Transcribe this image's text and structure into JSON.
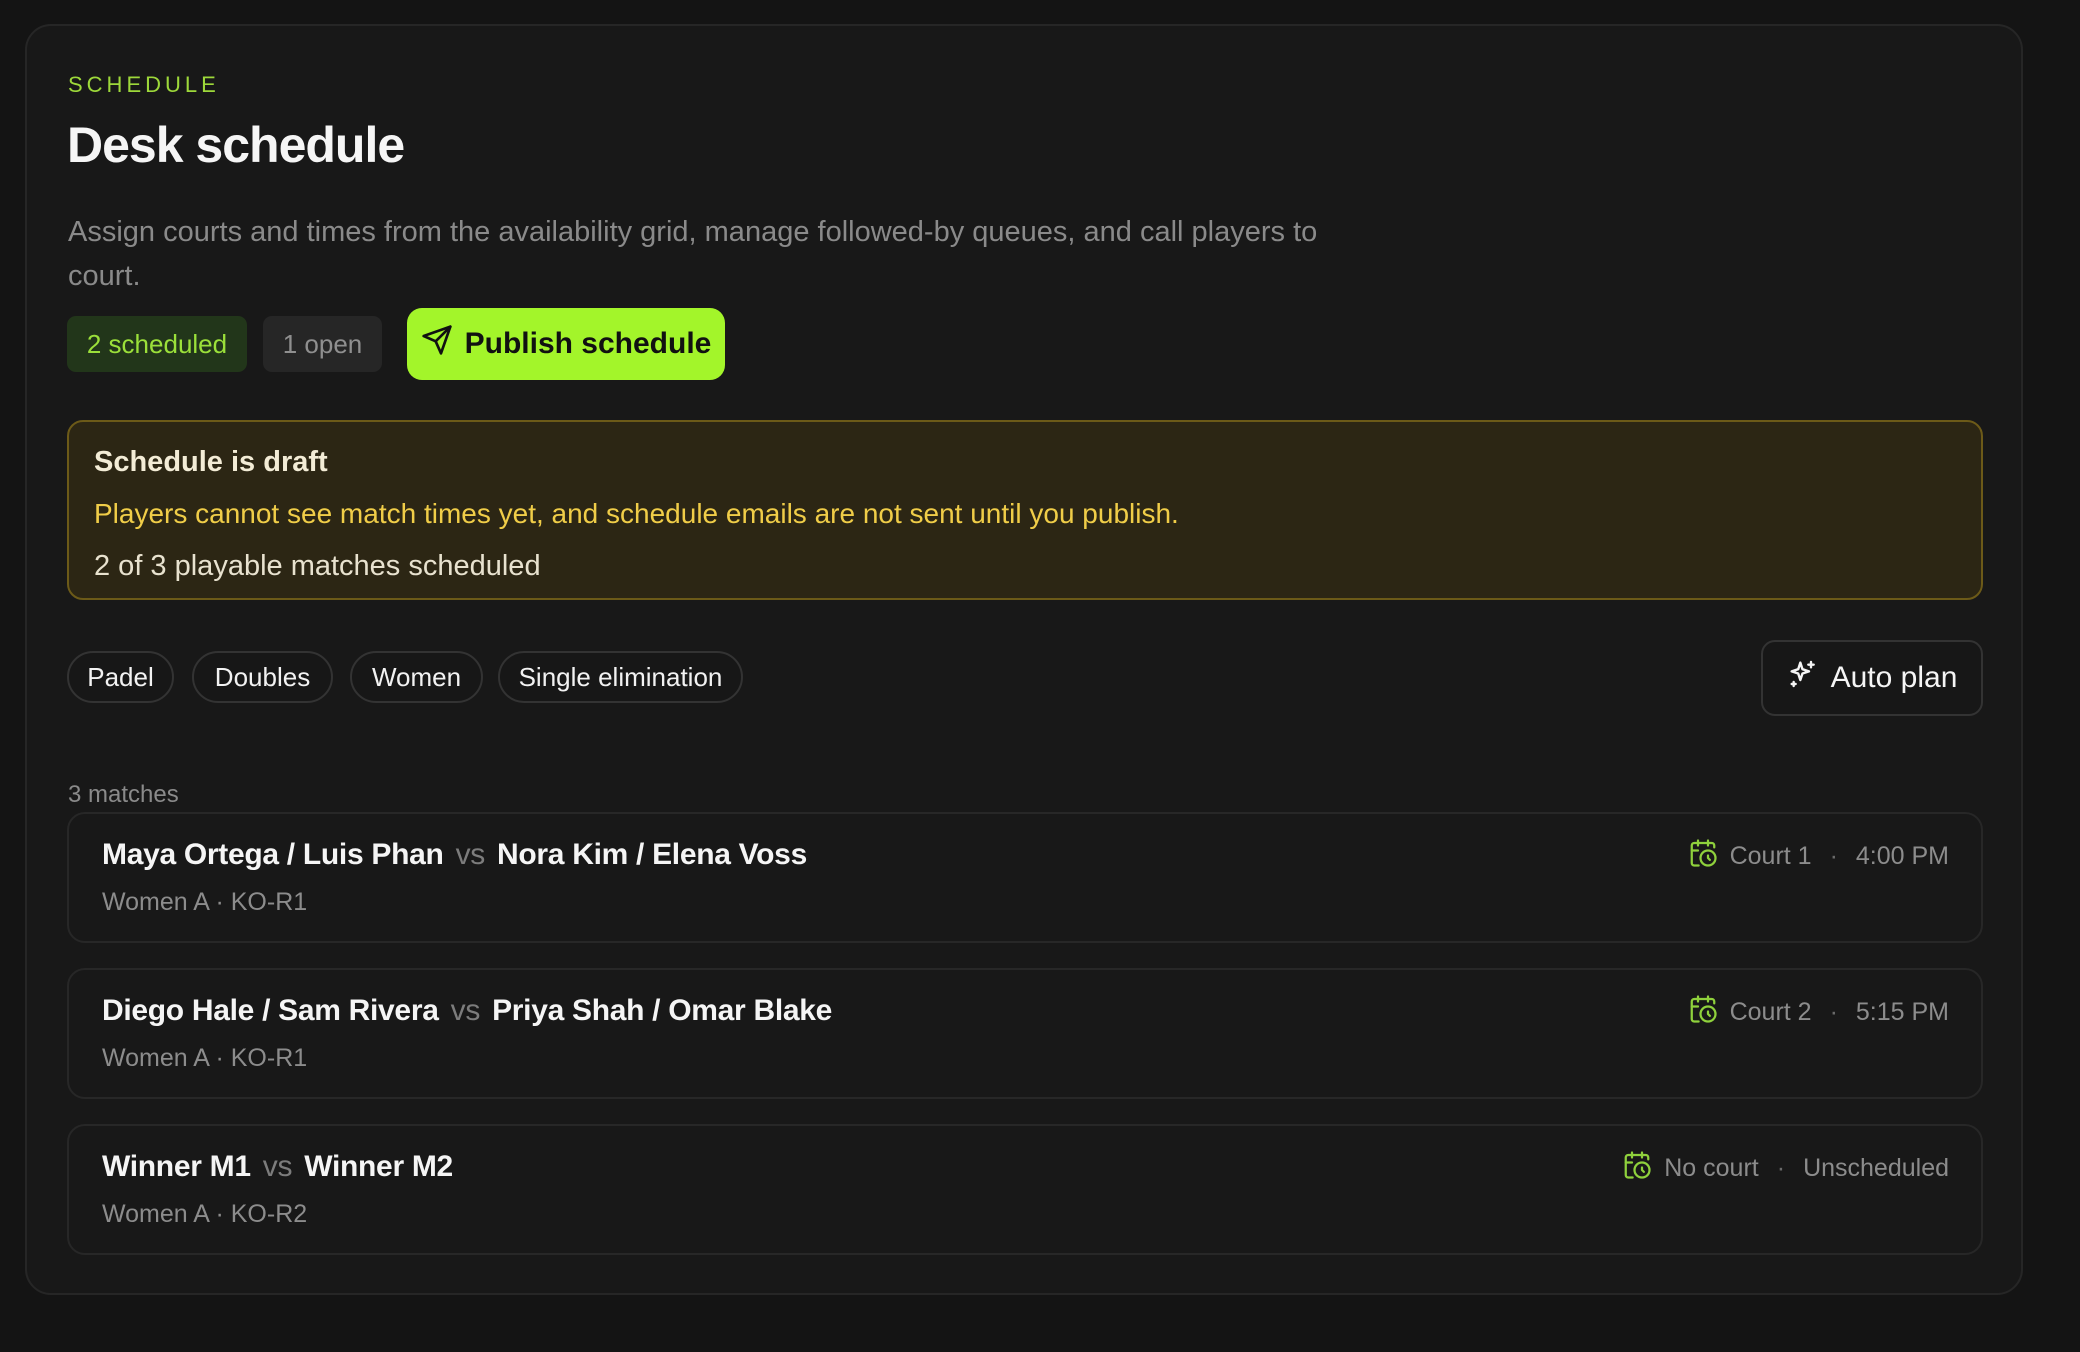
{
  "header": {
    "eyebrow": "SCHEDULE",
    "title": "Desk schedule",
    "subtitle": "Assign courts and times from the availability grid, manage followed-by queues, and call players to court."
  },
  "status": {
    "scheduled": "2 scheduled",
    "open": "1 open",
    "publish_label": "Publish schedule"
  },
  "draft": {
    "title": "Schedule is draft",
    "description": "Players cannot see match times yet, and schedule emails are not sent until you publish.",
    "progress": "2 of 3 playable matches scheduled"
  },
  "filters": {
    "tags": [
      "Padel",
      "Doubles",
      "Women",
      "Single elimination"
    ],
    "auto_plan_label": "Auto plan"
  },
  "matches": {
    "count_label": "3 matches",
    "vs_label": "vs",
    "items": [
      {
        "team_a": "Maya Ortega / Luis Phan",
        "team_b": "Nora Kim / Elena Voss",
        "meta": "Women A · KO-R1",
        "court": "Court 1",
        "time": "4:00 PM"
      },
      {
        "team_a": "Diego Hale / Sam Rivera",
        "team_b": "Priya Shah / Omar Blake",
        "meta": "Women A · KO-R1",
        "court": "Court 2",
        "time": "5:15 PM"
      },
      {
        "team_a": "Winner M1",
        "team_b": "Winner M2",
        "meta": "Women A · KO-R2",
        "court": "No court",
        "time": "Unscheduled"
      }
    ]
  },
  "colors": {
    "accent": "#a3f52a",
    "eyebrow": "#9dd83a",
    "draft_bg": "#2c2614",
    "draft_text": "#f0cd48"
  },
  "icons": {
    "publish": "send-icon",
    "auto_plan": "sparkles-icon",
    "slot": "calendar-clock-icon"
  }
}
